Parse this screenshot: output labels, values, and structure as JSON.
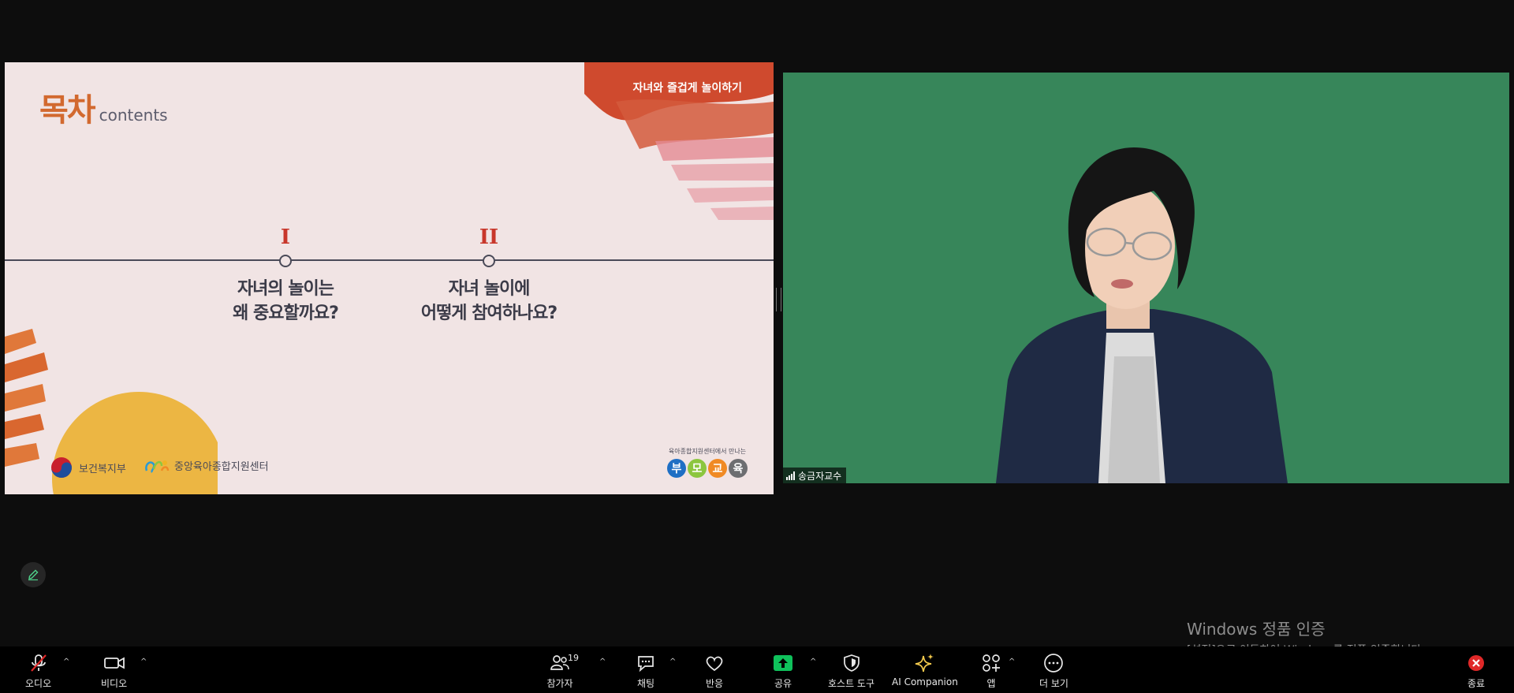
{
  "slide": {
    "title_ko": "목차",
    "title_en": "contents",
    "subtitle": "자녀와 즐겁게 놀이하기",
    "items": [
      {
        "num": "I",
        "text": "자녀의 놀이는\n왜 중요할까요?"
      },
      {
        "num": "II",
        "text": "자녀 놀이에\n어떻게 참여하나요?"
      }
    ],
    "logo_ministry": "보건복지부",
    "logo_center": "중앙육아종합지원센터",
    "bumo_caption": "육아종합지원센터에서 만나는",
    "bumo_letters": [
      "부",
      "모",
      "교",
      "육"
    ],
    "bumo_colors": [
      "#1f6fc4",
      "#8cc63f",
      "#f08a24",
      "#6d6e71"
    ]
  },
  "video": {
    "participant_name": "송금자교수",
    "background": "#37865a"
  },
  "watermark": {
    "line1": "Windows 정품 인증",
    "line2": "[설정]으로 이동하여 Windows를 정품 인증합니다."
  },
  "toolbar": {
    "audio": "오디오",
    "video": "비디오",
    "participants": "참가자",
    "participants_count": "19",
    "chat": "채팅",
    "reactions": "반응",
    "share": "공유",
    "host_tools": "호스트 도구",
    "ai_companion": "AI Companion",
    "apps": "앱",
    "more": "더 보기",
    "end": "종료"
  },
  "colors": {
    "share_green": "#0fc15b",
    "end_red": "#e02828",
    "ai_gold": "#f2c94c",
    "accent_orange": "#d2692f"
  }
}
